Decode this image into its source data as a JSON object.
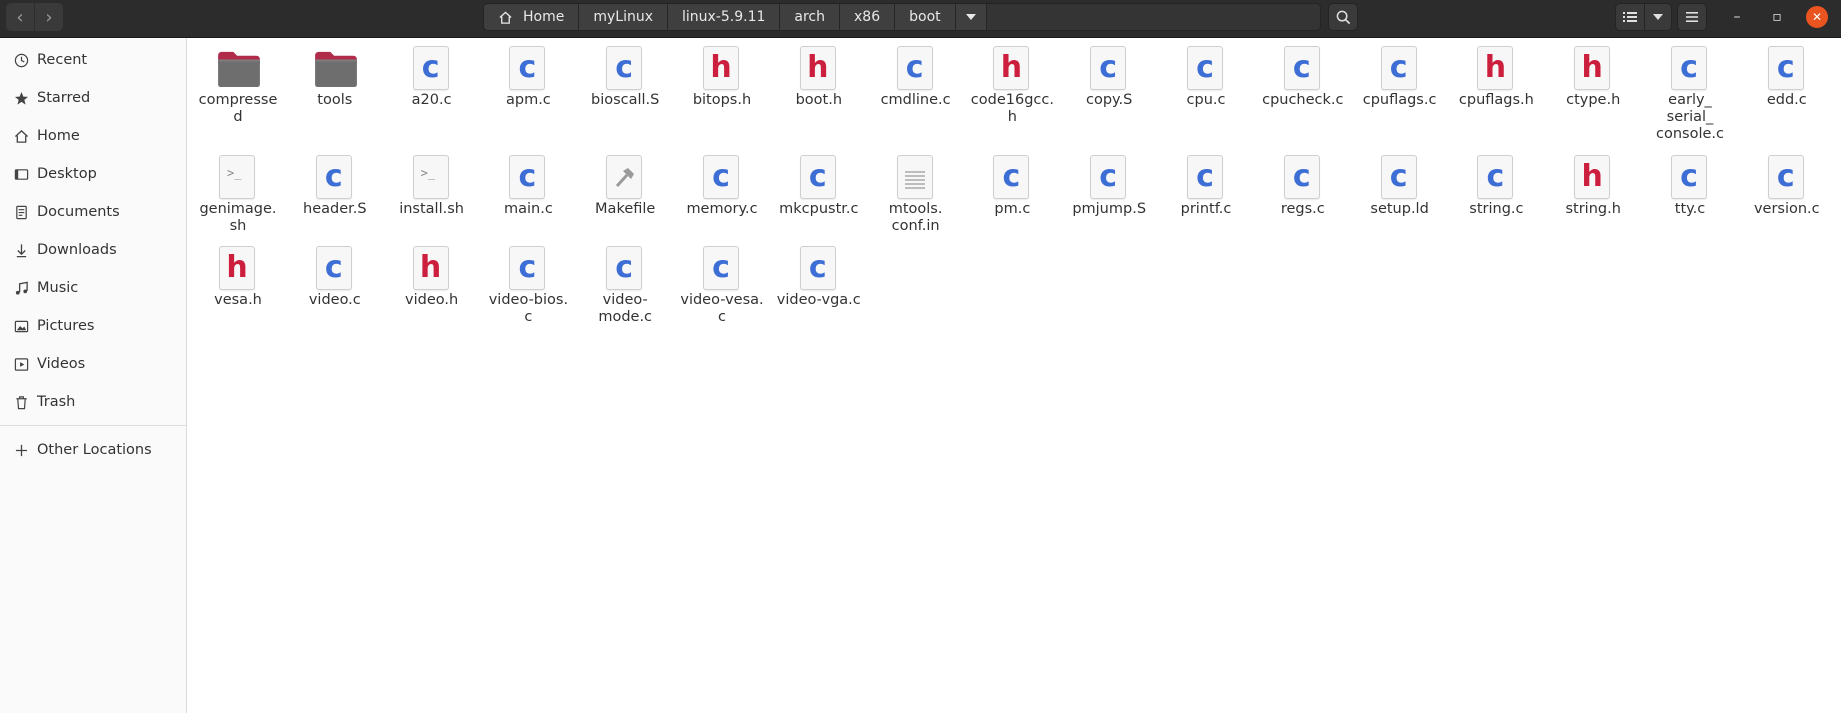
{
  "window": {
    "nav_back": "‹",
    "nav_forward": "›",
    "minimize": "–",
    "maximize": "▫",
    "close": "✕",
    "accent_close_color": "#e95420"
  },
  "breadcrumbs": [
    "Home",
    "myLinux",
    "linux-5.9.11",
    "arch",
    "x86",
    "boot"
  ],
  "sidebar": {
    "items": [
      {
        "label": "Recent",
        "icon": "clock-icon"
      },
      {
        "label": "Starred",
        "icon": "star-icon"
      },
      {
        "label": "Home",
        "icon": "home-icon"
      },
      {
        "label": "Desktop",
        "icon": "desktop-icon"
      },
      {
        "label": "Documents",
        "icon": "document-icon"
      },
      {
        "label": "Downloads",
        "icon": "download-icon"
      },
      {
        "label": "Music",
        "icon": "music-icon"
      },
      {
        "label": "Pictures",
        "icon": "picture-icon"
      },
      {
        "label": "Videos",
        "icon": "video-icon"
      },
      {
        "label": "Trash",
        "icon": "trash-icon"
      }
    ],
    "other_locations": "Other Locations"
  },
  "files": [
    {
      "name": "compresse d",
      "type": "folder"
    },
    {
      "name": "tools",
      "type": "folder"
    },
    {
      "name": "a20.c",
      "type": "c"
    },
    {
      "name": "apm.c",
      "type": "c"
    },
    {
      "name": "bioscall.S",
      "type": "c"
    },
    {
      "name": "bitops.h",
      "type": "h"
    },
    {
      "name": "boot.h",
      "type": "h"
    },
    {
      "name": "cmdline.c",
      "type": "c"
    },
    {
      "name": "code16gcc. h",
      "type": "h"
    },
    {
      "name": "copy.S",
      "type": "c"
    },
    {
      "name": "cpu.c",
      "type": "c"
    },
    {
      "name": "cpucheck.c",
      "type": "c"
    },
    {
      "name": "cpuflags.c",
      "type": "c"
    },
    {
      "name": "cpuflags.h",
      "type": "h"
    },
    {
      "name": "ctype.h",
      "type": "h"
    },
    {
      "name": "early_ serial_ console.c",
      "type": "c"
    },
    {
      "name": "edd.c",
      "type": "c"
    },
    {
      "name": "genimage. sh",
      "type": "sh"
    },
    {
      "name": "header.S",
      "type": "c"
    },
    {
      "name": "install.sh",
      "type": "sh"
    },
    {
      "name": "main.c",
      "type": "c"
    },
    {
      "name": "Makefile",
      "type": "make"
    },
    {
      "name": "memory.c",
      "type": "c"
    },
    {
      "name": "mkcpustr.c",
      "type": "c"
    },
    {
      "name": "mtools. conf.in",
      "type": "text"
    },
    {
      "name": "pm.c",
      "type": "c"
    },
    {
      "name": "pmjump.S",
      "type": "c"
    },
    {
      "name": "printf.c",
      "type": "c"
    },
    {
      "name": "regs.c",
      "type": "c"
    },
    {
      "name": "setup.ld",
      "type": "c"
    },
    {
      "name": "string.c",
      "type": "c"
    },
    {
      "name": "string.h",
      "type": "h"
    },
    {
      "name": "tty.c",
      "type": "c"
    },
    {
      "name": "version.c",
      "type": "c"
    },
    {
      "name": "vesa.h",
      "type": "h"
    },
    {
      "name": "video.c",
      "type": "c"
    },
    {
      "name": "video.h",
      "type": "h"
    },
    {
      "name": "video-bios. c",
      "type": "c"
    },
    {
      "name": "video- mode.c",
      "type": "c"
    },
    {
      "name": "video-vesa. c",
      "type": "c"
    },
    {
      "name": "video-vga.c",
      "type": "c"
    }
  ]
}
